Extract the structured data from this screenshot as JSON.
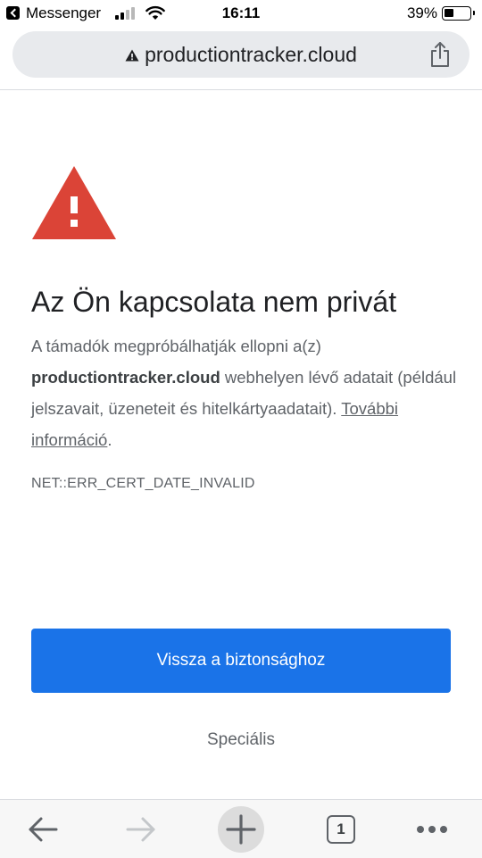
{
  "status_bar": {
    "app_name": "Messenger",
    "time": "16:11",
    "battery_percent": "39%",
    "battery_level": 0.39,
    "signal_bars": 2
  },
  "url_bar": {
    "security_icon": "warning-triangle-icon",
    "url": "productiontracker.cloud",
    "share_icon": "share-icon"
  },
  "interstitial": {
    "icon": "warning-triangle-icon",
    "icon_color": "#db4437",
    "heading": "Az Ön kapcsolata nem privát",
    "body_prefix": "A támadók megpróbálhatják ellopni a(z) ",
    "body_domain": "productiontracker.cloud",
    "body_suffix": " webhelyen lévő adatait (például jelszavait, üzeneteit és hitelkártyaadatait). ",
    "learn_more": "További információ",
    "learn_more_trailing": ".",
    "error_code": "NET::ERR_CERT_DATE_INVALID",
    "primary_button": "Vissza a biztonsághoz",
    "primary_color": "#1a73e8",
    "advanced_link": "Speciális"
  },
  "toolbar": {
    "back_icon": "back-arrow-icon",
    "forward_icon": "forward-arrow-icon",
    "new_tab_icon": "plus-icon",
    "tab_count": "1",
    "menu_icon": "more-dots-icon"
  }
}
